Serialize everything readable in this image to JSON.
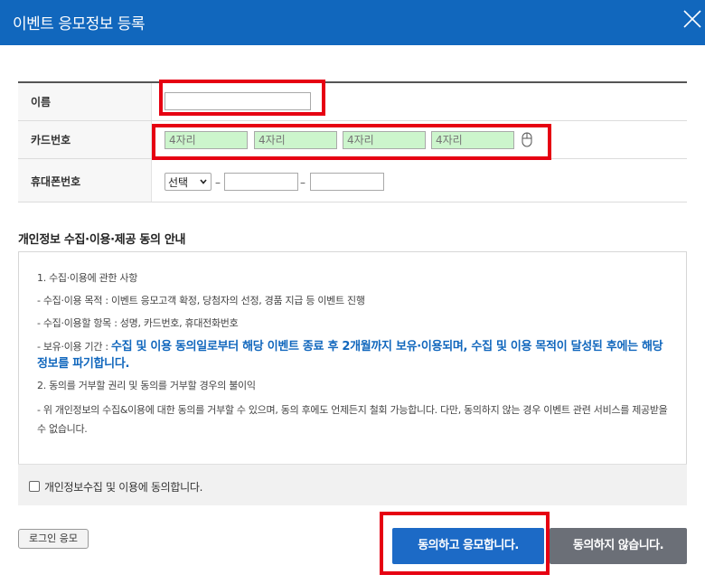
{
  "window": {
    "title": "이벤트 응모정보 등록"
  },
  "form": {
    "name_label": "이름",
    "name_value": "",
    "card_label": "카드번호",
    "card_placeholders": [
      "4자리",
      "4자리",
      "4자리",
      "4자리"
    ],
    "phone_label": "휴대폰번호",
    "phone_select_value": "선택",
    "phone_dash_1": "–",
    "phone_dash_2": "–"
  },
  "privacy": {
    "title": "개인정보 수집·이용·제공 동의 안내",
    "item1": "1. 수집·이용에 관한 사항",
    "item1_purpose": "- 수집·이용 목적 : 이벤트 응모고객 확정, 당첨자의 선정, 경품 지급 등 이벤트 진행",
    "item1_fields": "- 수집·이용할 항목 : 성명, 카드번호, 휴대전화번호",
    "item1_period_prefix": "- 보유·이용 기간 : ",
    "item1_period_emphasis": "수집 및 이용 동의일로부터 해당 이벤트 종료 후 2개월까지 보유·이용되며, 수집 및 이용 목적이 달성된 후에는 해당 정보를 파기합니다.",
    "item2": "2. 동의를 거부할 권리 및 동의를 거부할 경우의 불이익",
    "item2_desc": "- 위 개인정보의 수집&이용에 대한 동의를 거부할 수 있으며, 동의 후에도 언제든지 철회 가능합니다. 다만, 동의하지 않는 경우 이벤트 관련 서비스를 제공받을 수 없습니다."
  },
  "consent": {
    "checkbox_label": "개인정보수집 및 이용에 동의합니다.",
    "checked": false
  },
  "buttons": {
    "login_apply": "로그인 응모",
    "agree_apply": "동의하고 응모합니다.",
    "disagree": "동의하지 않습니다."
  },
  "colors": {
    "titlebar": "#1167bd",
    "highlight": "#e60012",
    "field_green": "#ccf5cc",
    "emphasis_text": "#1167bd",
    "agree_button": "#1c6ac6",
    "disagree_button": "#6b6f77"
  },
  "icons": {
    "close": "close-icon",
    "mouse": "mouse-icon"
  }
}
